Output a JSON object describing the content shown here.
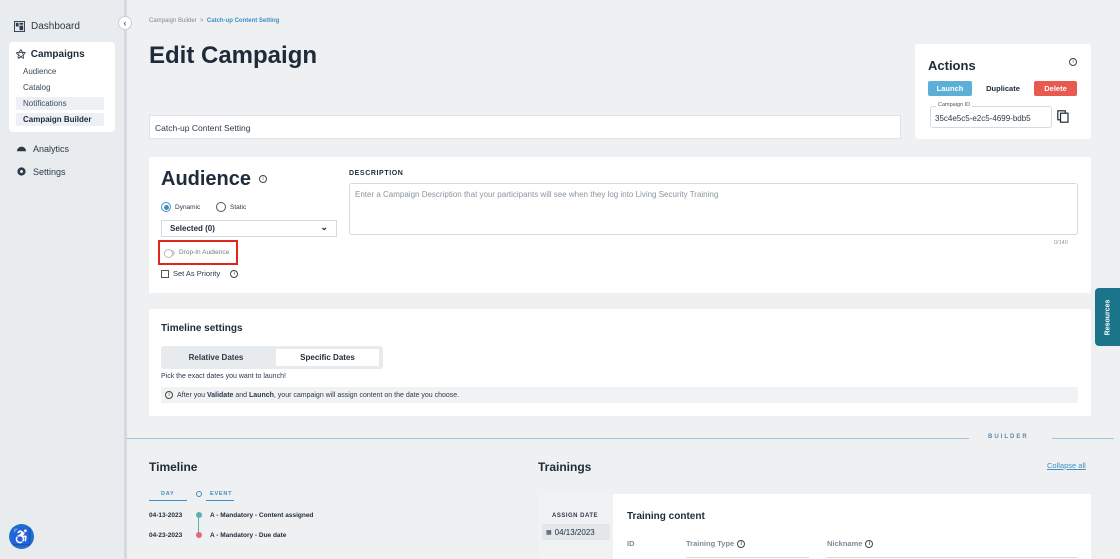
{
  "sidebar": {
    "dashboard": "Dashboard",
    "campaigns": "Campaigns",
    "sub_items": [
      "Audience",
      "Catalog",
      "Notifications",
      "Campaign Builder"
    ],
    "analytics": "Analytics",
    "settings": "Settings"
  },
  "breadcrumb": {
    "parent": "Campaign Builder",
    "separator": ">",
    "current": "Catch-up Content Setting"
  },
  "page": {
    "title": "Edit Campaign",
    "campaign_name": "Catch-up Content Setting"
  },
  "actions": {
    "title": "Actions",
    "launch": "Launch",
    "duplicate": "Duplicate",
    "delete": "Delete",
    "campaign_id_label": "Campaign ID",
    "campaign_id_value": "35c4e5c5-e2c5-4699-bdb5"
  },
  "audience": {
    "title": "Audience",
    "dynamic": "Dynamic",
    "static": "Static",
    "selected": "Selected (0)",
    "dropin": "Drop-In Audience",
    "priority": "Set As Priority",
    "description_label": "DESCRIPTION",
    "description_placeholder": "Enter a Campaign Description that your participants will see when they log into Living Security Training",
    "char_count": "0/140"
  },
  "timeline_settings": {
    "title": "Timeline settings",
    "relative": "Relative Dates",
    "specific": "Specific Dates",
    "hint": "Pick the exact dates you want to launch!",
    "note_prefix": "After you ",
    "note_validate": "Validate",
    "note_and": " and ",
    "note_launch": "Launch",
    "note_suffix": ", your campaign will assign content on the date you choose."
  },
  "builder": {
    "label": "BUILDER",
    "timeline_title": "Timeline",
    "trainings_title": "Trainings",
    "collapse_all": "Collapse all",
    "col_day": "DAY",
    "col_event": "EVENT",
    "events": [
      {
        "date": "04-13-2023",
        "text": "A - Mandatory - Content assigned"
      },
      {
        "date": "04-23-2023",
        "text": "A - Mandatory - Due date"
      }
    ],
    "assign_date_label": "ASSIGN DATE",
    "assign_date_value": "04/13/2023",
    "training_content": "Training content",
    "col_id": "ID",
    "col_training_type": "Training Type",
    "col_nickname": "Nickname"
  },
  "resources": "Resources",
  "colors": {
    "accent": "#3d8fc4",
    "launch": "#5cb0d8",
    "delete": "#e85a4f",
    "highlight": "#e0261c",
    "resources": "#1b7489"
  }
}
